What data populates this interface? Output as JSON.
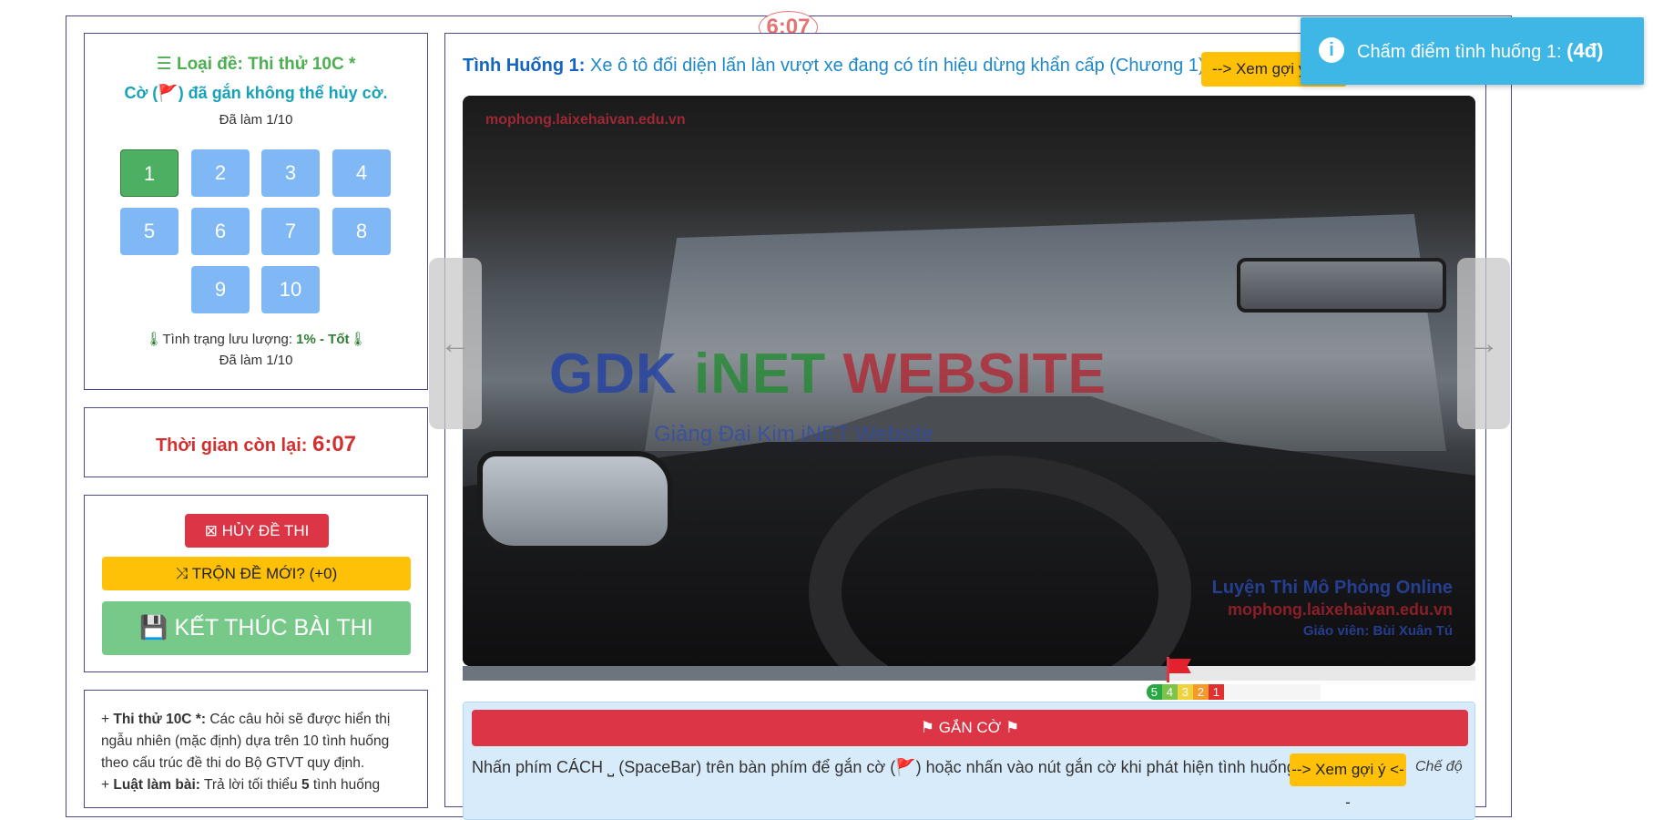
{
  "timer_badge": "6:07",
  "sidebar": {
    "exam_type_label": "Loại đề: Thi thử 10C *",
    "flag_note": "Cờ (🚩) đã gắn không thể hủy cờ.",
    "done_count": "Đã làm 1/10",
    "questions": [
      "1",
      "2",
      "3",
      "4",
      "5",
      "6",
      "7",
      "8",
      "9",
      "10"
    ],
    "active_question": "1",
    "storage_label": "Tình trạng lưu lượng: ",
    "storage_value": "1% - Tốt",
    "done_count_2": "Đã làm 1/10"
  },
  "time_panel": {
    "label": "Thời gian còn lại: ",
    "value": "6:07"
  },
  "actions": {
    "cancel_label": "HỦY ĐỀ THI",
    "shuffle_label": "TRỘN ĐỀ MỚI? (+0)",
    "finish_label": "KẾT THÚC BÀI THI"
  },
  "notes": {
    "line1_bold": "Thi thử 10C *:",
    "line1_text": " Các câu hỏi sẽ được hiển thị ngẫu nhiên (mặc định) dựa trên 10 tình huống theo cấu trúc đề thi do Bộ GTVT quy định.",
    "line2_bold": "Luật làm bài:",
    "line2_text": " Trả lời tối thiểu ",
    "line2_num": "5",
    "line2_end": " tình huống"
  },
  "question": {
    "number_label": "Tình Huống 1:",
    "text": " Xe ô tô đối diện lấn làn vượt xe đang có tín hiệu dừng khẩn cấp (Chương 1)",
    "hint_label": "--> Xem gợi ý <--"
  },
  "video": {
    "watermark_site": "mophong.laixehaivan.edu.vn",
    "watermark_brand_a": "GDK ",
    "watermark_brand_b": "iNET ",
    "watermark_brand_c": "WEBSITE",
    "watermark_sub": "Giảng Đại Kim  iNET Website",
    "watermark_br1": "Luyện Thi Mô Phỏng Online",
    "watermark_br2": "mophong.laixehaivan.edu.vn",
    "watermark_br3": "Giáo viên: Bùi Xuân Tú",
    "progress_fraction": 0.695
  },
  "score_scale": [
    "5",
    "4",
    "3",
    "2",
    "1"
  ],
  "flag_panel": {
    "button_label": "GẮN CỜ",
    "instruction": "Nhấn phím CÁCH ⎵ (SpaceBar) trên bàn phím để gắn cờ (🚩) hoặc nhấn vào nút gắn cờ khi phát hiện tình huống.",
    "hint_label": "--> Xem gợi ý <--",
    "mode_label": "Chế độ"
  },
  "toast": {
    "text": "Chấm điểm tình huống 1: ",
    "score": "(4đ)"
  },
  "colors": {
    "accent_blue": "#1e88c8",
    "danger": "#dc3545",
    "warning": "#ffc107",
    "success": "#77c98a",
    "toast": "#3fb7e6"
  }
}
